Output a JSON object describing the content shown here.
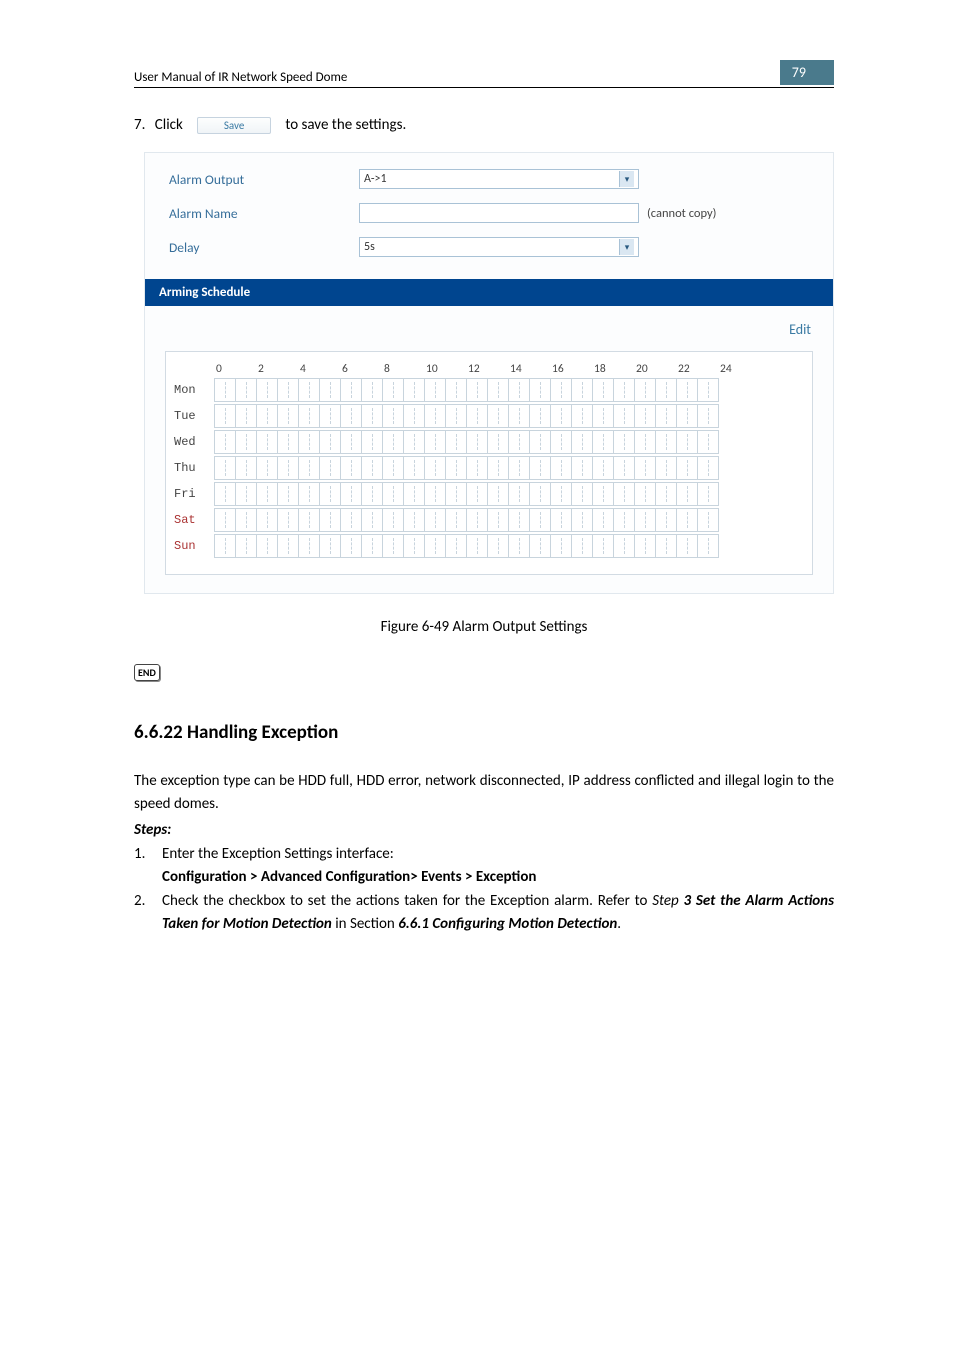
{
  "header": {
    "title": "User Manual of IR Network Speed Dome",
    "page": "79"
  },
  "step7": {
    "num": "7.",
    "pre": "Click",
    "btn": "Save",
    "post": "to save the settings."
  },
  "form": {
    "alarm_output_label": "Alarm Output",
    "alarm_output_value": "A->1",
    "alarm_name_label": "Alarm Name",
    "alarm_name_value": "",
    "alarm_name_hint": "(cannot copy)",
    "delay_label": "Delay",
    "delay_value": "5s"
  },
  "schedule": {
    "title": "Arming Schedule",
    "edit": "Edit",
    "ticks": [
      "0",
      "2",
      "4",
      "6",
      "8",
      "10",
      "12",
      "14",
      "16",
      "18",
      "20",
      "22",
      "24"
    ],
    "days": [
      {
        "label": "Mon",
        "weekend": false
      },
      {
        "label": "Tue",
        "weekend": false
      },
      {
        "label": "Wed",
        "weekend": false
      },
      {
        "label": "Thu",
        "weekend": false
      },
      {
        "label": "Fri",
        "weekend": false
      },
      {
        "label": "Sat",
        "weekend": true
      },
      {
        "label": "Sun",
        "weekend": true
      }
    ]
  },
  "figure_caption": "Figure 6-49 Alarm Output Settings",
  "end_icon": "END",
  "section": {
    "heading": "6.6.22 Handling Exception",
    "para1": "The exception type can be HDD full, HDD error, network disconnected, IP address conflicted and illegal login to the speed domes.",
    "steps_label": "Steps:",
    "item1_num": "1.",
    "item1_text": "Enter the Exception Settings interface:",
    "item1_path": "Configuration > Advanced Configuration> Events > Exception",
    "item2_num": "2.",
    "item2_pre": "Check the checkbox to set the actions taken for the Exception alarm. Refer to ",
    "item2_step_label": "Step ",
    "item2_step_bold": "3 Set the Alarm Actions Taken for Motion Detection",
    "item2_mid": " in Section ",
    "item2_sec": "6.6.1 Configuring Motion Detection",
    "item2_end": "."
  }
}
